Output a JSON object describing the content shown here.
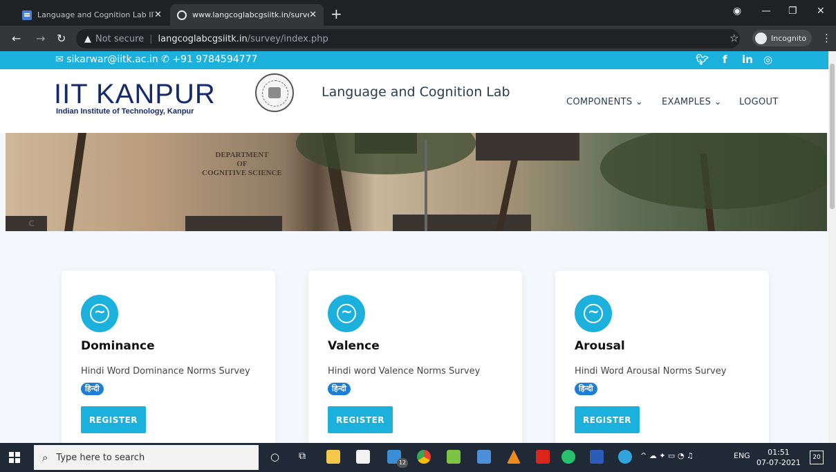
{
  "browser": {
    "tabs": [
      {
        "title": "Language and Cognition Lab IITK",
        "close": "✕"
      },
      {
        "title": "www.langcoglabcgsiitk.in/survey/",
        "close": "✕"
      }
    ],
    "new_tab": "+",
    "address": {
      "security": "Not secure",
      "host": "langcoglabcgsiitk.in",
      "path": "/survey/index.php"
    },
    "profile_label": "Incognito"
  },
  "topbar": {
    "email": "sikarwar@iitk.ac.in",
    "phone": "+91 9784594777",
    "social": [
      "twitter-icon",
      "facebook-icon",
      "linkedin-icon",
      "instagram-icon"
    ]
  },
  "header": {
    "logo_main": "IIT KANPUR",
    "logo_sub": "Indian Institute of Technology, Kanpur",
    "lab_title": "Language and Cognition Lab",
    "nav": [
      {
        "label": "COMPONENTS ⌄"
      },
      {
        "label": "EXAMPLES ⌄"
      },
      {
        "label": "LOGOUT"
      }
    ]
  },
  "hero": {
    "sign": "DEPARTMENT\nOF\nCOGNITIVE SCIENCE",
    "corner_letter": "C"
  },
  "cards": [
    {
      "title": "Dominance",
      "description": "Hindi Word Dominance Norms Survey",
      "badge": "हिन्दी",
      "button": "REGISTER"
    },
    {
      "title": "Valence",
      "description": "Hindi word Valence Norms Survey",
      "badge": "हिन्दी",
      "button": "REGISTER"
    },
    {
      "title": "Arousal",
      "description": "Hindi Word Arousal Norms Survey",
      "badge": "हिन्दी",
      "button": "REGISTER"
    }
  ],
  "taskbar": {
    "search_placeholder": "Type here to search",
    "tray_lang": "ENG",
    "time": "01:51",
    "date": "07-07-2021",
    "notifications": "20",
    "mail_badge": "12"
  }
}
